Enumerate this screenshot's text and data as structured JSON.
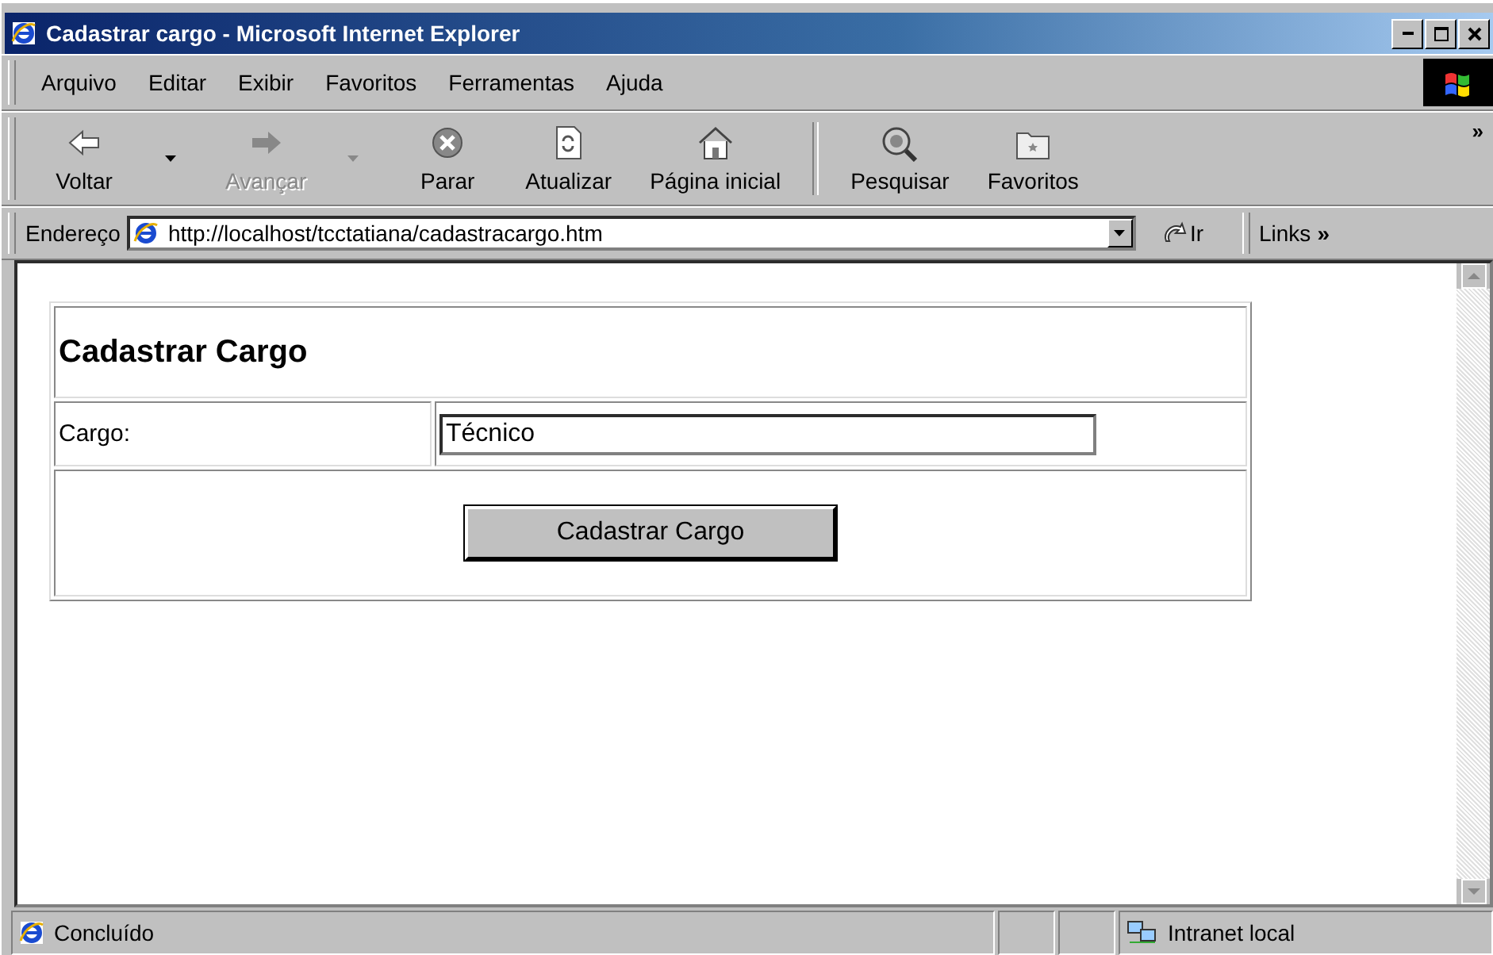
{
  "window": {
    "title": "Cadastrar cargo - Microsoft Internet Explorer"
  },
  "menu": [
    {
      "label": "Arquivo"
    },
    {
      "label": "Editar"
    },
    {
      "label": "Exibir"
    },
    {
      "label": "Favoritos"
    },
    {
      "label": "Ferramentas"
    },
    {
      "label": "Ajuda"
    }
  ],
  "toolbar_more": "»",
  "toolbar": [
    {
      "label": "Voltar",
      "kind": "back",
      "disabled": false,
      "dropdown": true
    },
    {
      "label": "Avançar",
      "kind": "forward",
      "disabled": true,
      "dropdown": true
    },
    {
      "label": "Parar",
      "kind": "stop",
      "disabled": false,
      "dropdown": false
    },
    {
      "label": "Atualizar",
      "kind": "refresh",
      "disabled": false,
      "dropdown": false
    },
    {
      "label": "Página inicial",
      "kind": "home",
      "disabled": false,
      "dropdown": false
    },
    {
      "label": "Pesquisar",
      "kind": "search",
      "disabled": false,
      "dropdown": false
    },
    {
      "label": "Favoritos",
      "kind": "favorites",
      "disabled": false,
      "dropdown": false
    }
  ],
  "address": {
    "label": "Endereço",
    "value": "http://localhost/tcctatiana/cadastracargo.htm",
    "go": "Ir",
    "links": "Links",
    "links_more": "»"
  },
  "form": {
    "heading": "Cadastrar Cargo",
    "field_label": "Cargo:",
    "field_value": "Técnico",
    "submit": "Cadastrar Cargo"
  },
  "status_bar": {
    "text": "Concluído",
    "zone": "Intranet local"
  }
}
